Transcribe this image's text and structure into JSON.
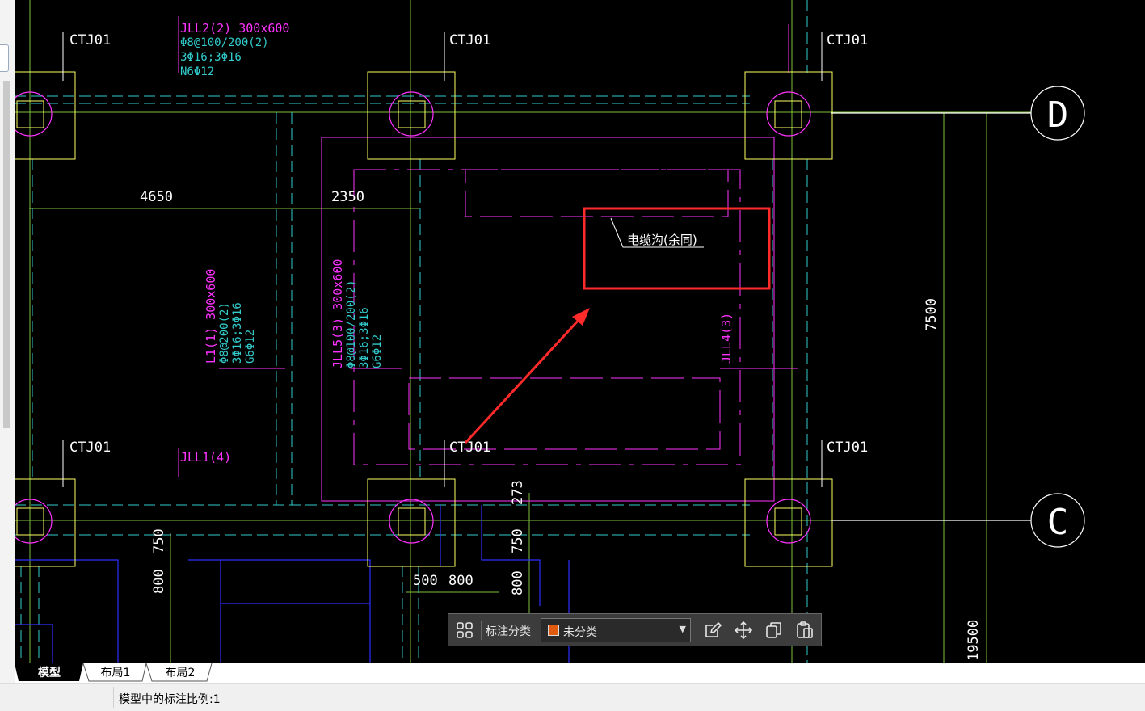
{
  "drawing": {
    "column_labels": [
      "CTJ01",
      "CTJ01",
      "CTJ01",
      "CTJ01",
      "CTJ01",
      "CTJ01"
    ],
    "beam_notes": {
      "jll2": [
        "JLL2(2) 300x600",
        "Φ8@100/200(2)",
        "3Φ16;3Φ16",
        "N6Φ12"
      ],
      "l1": [
        "L1(1) 300x600",
        "Φ8@200(2)",
        "3Φ16;3Φ16",
        "G6Φ12"
      ],
      "jll5": [
        "JLL5(3) 300x600",
        "Φ8@100/200(2)",
        "3Φ16;3Φ16",
        "G6Φ12"
      ],
      "jll4": "JLL4(3)",
      "jll1": "JLL1(4)"
    },
    "dimensions": {
      "d4650": "4650",
      "d2350": "2350",
      "d7500": "7500",
      "d19500": "19500",
      "d750a": "750",
      "d800a": "800",
      "d500": "500",
      "d800b": "800",
      "d273": "273",
      "d750b": "750",
      "d800c": "800"
    },
    "axis_labels": {
      "d": "D",
      "c": "C"
    },
    "cable_trench_label": "电缆沟(余同)",
    "colors": {
      "background": "#000000",
      "axis": "#7fbf3f",
      "beam": "#ff33ff",
      "dashed": "#33cccc",
      "column": "#ffff66",
      "highlight": "#ff2a2a",
      "blue": "#2f2fff"
    }
  },
  "toolbar": {
    "category_label": "标注分类",
    "category_value": "未分类",
    "category_color": "#e05a10",
    "icons": [
      "grid-icon",
      "edit-icon",
      "move-icon",
      "copy-icon",
      "paste-icon"
    ]
  },
  "tabs": [
    {
      "label": "模型",
      "active": true
    },
    {
      "label": "布局1",
      "active": false
    },
    {
      "label": "布局2",
      "active": false
    }
  ],
  "status": {
    "scale_text": "模型中的标注比例:1"
  }
}
